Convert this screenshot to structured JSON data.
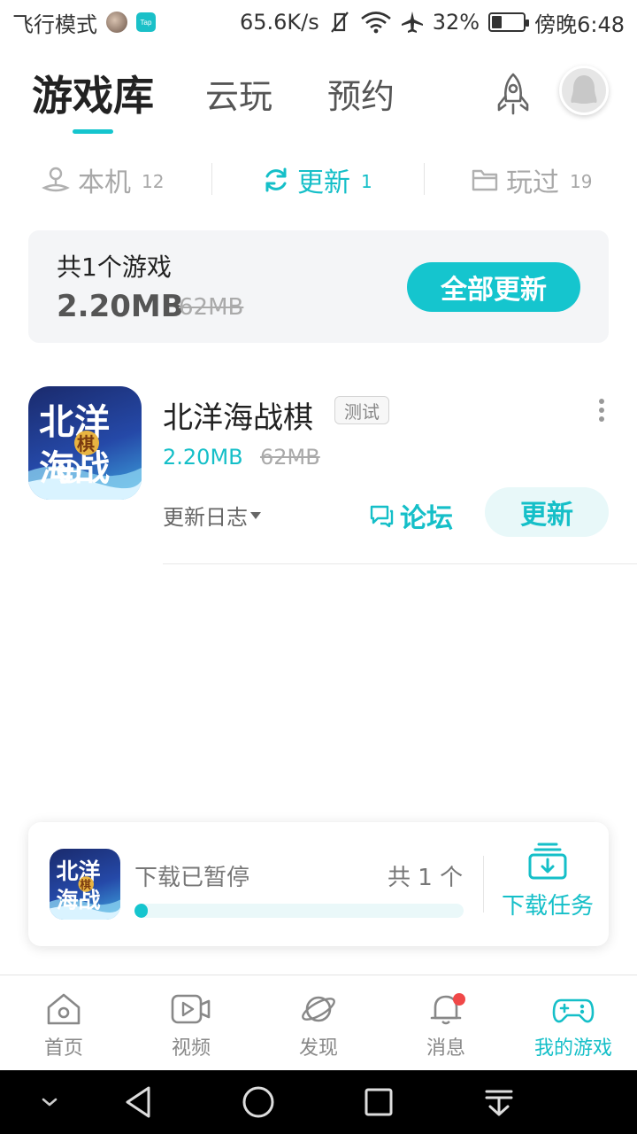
{
  "status_bar": {
    "airplane_mode_label": "飞行模式",
    "taptap_label": "Tap",
    "speed": "65.6K/s",
    "battery_percent": "32%",
    "battery_level": 0.32,
    "time": "傍晚6:48"
  },
  "header": {
    "tabs": [
      {
        "label": "游戏库",
        "active": true
      },
      {
        "label": "云玩",
        "active": false
      },
      {
        "label": "预约",
        "active": false
      }
    ]
  },
  "subtabs": [
    {
      "label": "本机",
      "count": "12",
      "icon": "device-icon",
      "active": false
    },
    {
      "label": "更新",
      "count": "1",
      "icon": "refresh-icon",
      "active": true
    },
    {
      "label": "玩过",
      "count": "19",
      "icon": "folder-icon",
      "active": false
    }
  ],
  "summary": {
    "title": "共1个游戏",
    "size": "2.20MB",
    "old_size": "62MB",
    "update_all_label": "全部更新"
  },
  "game": {
    "name": "北洋海战棋",
    "badge": "测试",
    "size": "2.20MB",
    "old_size": "62MB",
    "changelog_label": "更新日志",
    "forum_label": "论坛",
    "update_label": "更新",
    "icon_text_top": "北洋",
    "icon_text_bottom": "海战",
    "icon_badge": "棋"
  },
  "download": {
    "status": "下载已暂停",
    "count": "共 1 个",
    "progress": 0.02,
    "task_label": "下载任务"
  },
  "bottom_nav": [
    {
      "label": "首页",
      "icon": "home-icon",
      "active": false
    },
    {
      "label": "视频",
      "icon": "video-icon",
      "active": false
    },
    {
      "label": "发现",
      "icon": "planet-icon",
      "active": false
    },
    {
      "label": "消息",
      "icon": "bell-icon",
      "active": false
    },
    {
      "label": "我的游戏",
      "icon": "gamepad-icon",
      "active": true
    }
  ],
  "colors": {
    "accent": "#15c5ce",
    "accent_light": "#e8f8f9",
    "notification": "#f04848"
  }
}
